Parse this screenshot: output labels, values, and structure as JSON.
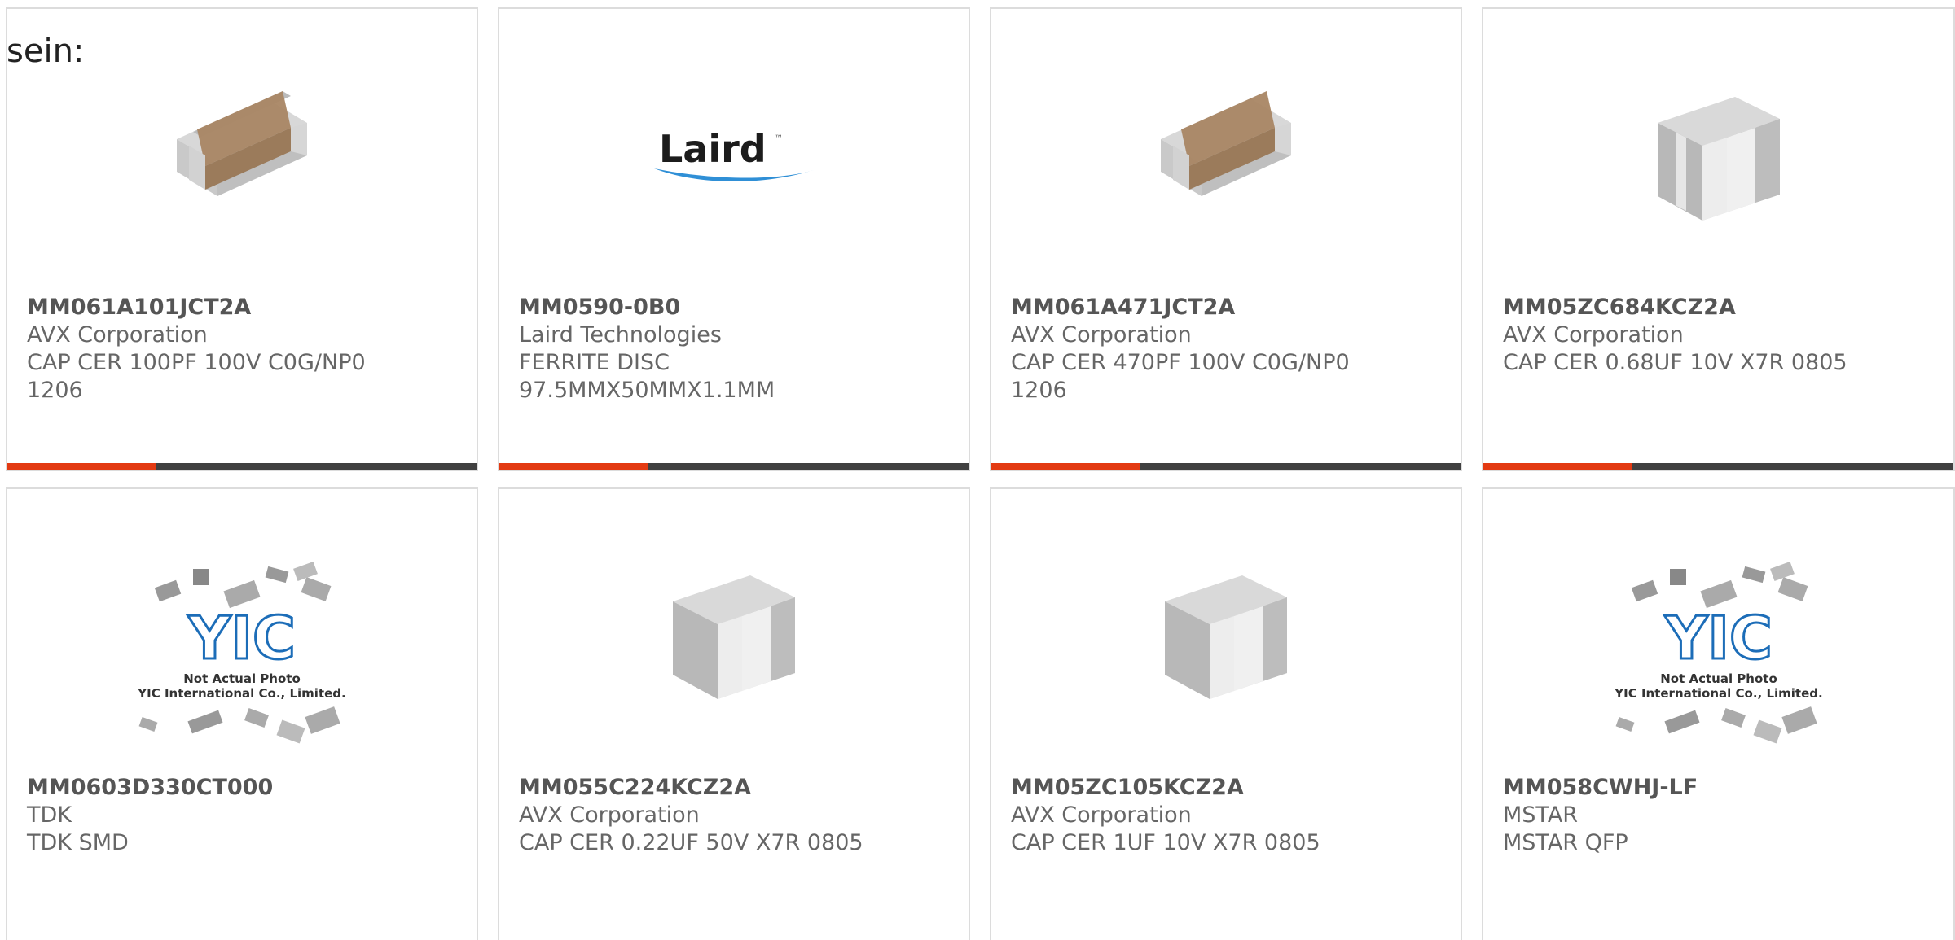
{
  "intro_text": "sein:",
  "colors": {
    "accent": "#e33a12",
    "bar": "#404040",
    "border": "#dcdcdc",
    "text": "#666666"
  },
  "products": [
    {
      "part_number": "MM061A101JCT2A",
      "manufacturer": "AVX Corporation",
      "description_1": "CAP CER 100PF 100V C0G/NP0",
      "description_2": "1206",
      "image": "brown-ceramic-chip-icon"
    },
    {
      "part_number": "MM0590-0B0",
      "manufacturer": "Laird Technologies",
      "description_1": "FERRITE DISC",
      "description_2": "97.5MMX50MMX1.1MM",
      "image": "laird-logo",
      "logo_text": "Laird",
      "logo_mark": "™"
    },
    {
      "part_number": "MM061A471JCT2A",
      "manufacturer": "AVX Corporation",
      "description_1": "CAP CER 470PF 100V C0G/NP0",
      "description_2": "1206",
      "image": "brown-ceramic-chip-icon"
    },
    {
      "part_number": "MM05ZC684KCZ2A",
      "manufacturer": "AVX Corporation",
      "description_1": "CAP CER 0.68UF 10V X7R 0805",
      "description_2": "",
      "image": "gray-ceramic-chip-icon"
    },
    {
      "part_number": "MM0603D330CT000",
      "manufacturer": "TDK",
      "description_1": "TDK SMD",
      "description_2": "",
      "image": "yic-placeholder",
      "placeholder_line_1": "Not Actual Photo",
      "placeholder_line_2": "YIC International Co., Limited."
    },
    {
      "part_number": "MM055C224KCZ2A",
      "manufacturer": "AVX Corporation",
      "description_1": "CAP CER 0.22UF 50V X7R 0805",
      "description_2": "",
      "image": "gray-ceramic-chip-icon"
    },
    {
      "part_number": "MM05ZC105KCZ2A",
      "manufacturer": "AVX Corporation",
      "description_1": "CAP CER 1UF 10V X7R 0805",
      "description_2": "",
      "image": "gray-ceramic-chip-icon"
    },
    {
      "part_number": "MM058CWHJ-LF",
      "manufacturer": "MSTAR",
      "description_1": "MSTAR QFP",
      "description_2": "",
      "image": "yic-placeholder",
      "placeholder_line_1": "Not Actual Photo",
      "placeholder_line_2": "YIC International Co., Limited."
    }
  ]
}
